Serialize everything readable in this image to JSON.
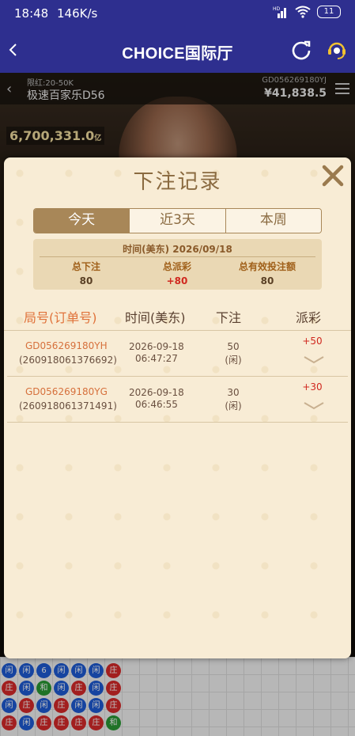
{
  "status_bar": {
    "time": "18:48",
    "speed": "146K/s",
    "battery": "11",
    "icons": [
      "hd-signal-icon",
      "wifi-icon",
      "battery-icon"
    ]
  },
  "nav": {
    "title": "CHOICE国际厅",
    "icons": [
      "back-chevron-icon",
      "refresh-icon",
      "customer-support-icon"
    ]
  },
  "game": {
    "limit": "限红:20-50K",
    "table_name": "极速百家乐D56",
    "round_id": "GD056269180YJ",
    "balance": "¥41,838.5",
    "pool_amount": "6,700,331.0",
    "pool_suffix": "亿"
  },
  "modal": {
    "title": "下注记录",
    "tabs": [
      {
        "label": "今天",
        "active": true
      },
      {
        "label": "近3天",
        "active": false
      },
      {
        "label": "本周",
        "active": false
      }
    ],
    "summary": {
      "date_label": "时间(美东) 2026/09/18",
      "total_bet_label": "总下注",
      "total_bet_value": "80",
      "total_payout_label": "总派彩",
      "total_payout_value": "+80",
      "total_valid_label": "总有效投注额",
      "total_valid_value": "80"
    },
    "columns": [
      "局号(订单号)",
      "时间(美东)",
      "下注",
      "派彩"
    ],
    "records": [
      {
        "round_id": "GD056269180YH",
        "order_id": "(260918061376692)",
        "date": "2026-09-18",
        "time": "06:47:27",
        "bet": "50",
        "side": "(闲)",
        "payout": "+50"
      },
      {
        "round_id": "GD056269180YG",
        "order_id": "(260918061371491)",
        "date": "2026-09-18",
        "time": "06:46:55",
        "bet": "30",
        "side": "(闲)",
        "payout": "+30"
      }
    ]
  },
  "roadmap": {
    "player_char": "闲",
    "banker_char": "庄",
    "tie_char": "和",
    "six_char": "6",
    "colors": {
      "player": "#1e5bd6",
      "banker": "#d82a2a",
      "tie": "#2a9a35"
    }
  }
}
